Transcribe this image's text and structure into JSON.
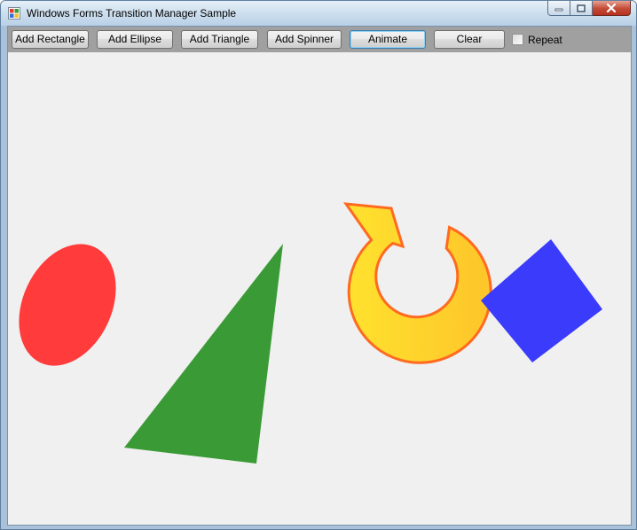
{
  "window": {
    "title": "Windows Forms Transition Manager Sample",
    "icon": "app-icon",
    "caption_buttons": [
      "minimize-icon",
      "maximize-icon",
      "close-icon"
    ]
  },
  "toolbar": {
    "add_rectangle": "Add Rectangle",
    "add_ellipse": "Add Ellipse",
    "add_triangle": "Add Triangle",
    "add_spinner": "Add Spinner",
    "animate": "Animate",
    "clear": "Clear",
    "repeat_label": "Repeat",
    "repeat_checked": false
  },
  "canvas": {
    "background": "#f0f0f0",
    "shapes": [
      {
        "kind": "ellipse",
        "color": "#ff3b3b"
      },
      {
        "kind": "triangle",
        "color": "#3a9a36"
      },
      {
        "kind": "spinner",
        "fill_start": "#ffe22e",
        "fill_end": "#fdc52a",
        "outline": "#ff6a20"
      },
      {
        "kind": "rectangle",
        "color": "#3b3bfb"
      }
    ]
  }
}
